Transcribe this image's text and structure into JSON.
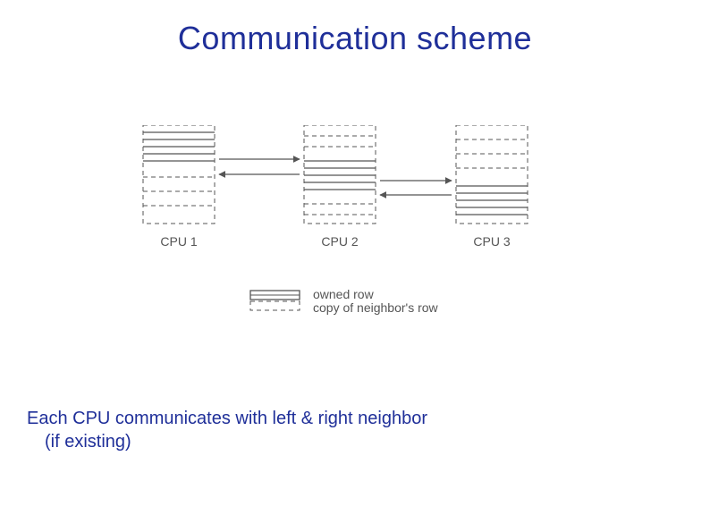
{
  "title": "Communication scheme",
  "body_line1": "Each CPU communicates with left & right neighbor",
  "body_line2": "(if existing)",
  "cpu_labels": {
    "cpu1": "CPU 1",
    "cpu2": "CPU 2",
    "cpu3": "CPU 3"
  },
  "legend": {
    "owned": "owned row",
    "copy": "copy of neighbor's row"
  },
  "colors": {
    "accent": "#1f2f99",
    "stroke": "#555555"
  }
}
